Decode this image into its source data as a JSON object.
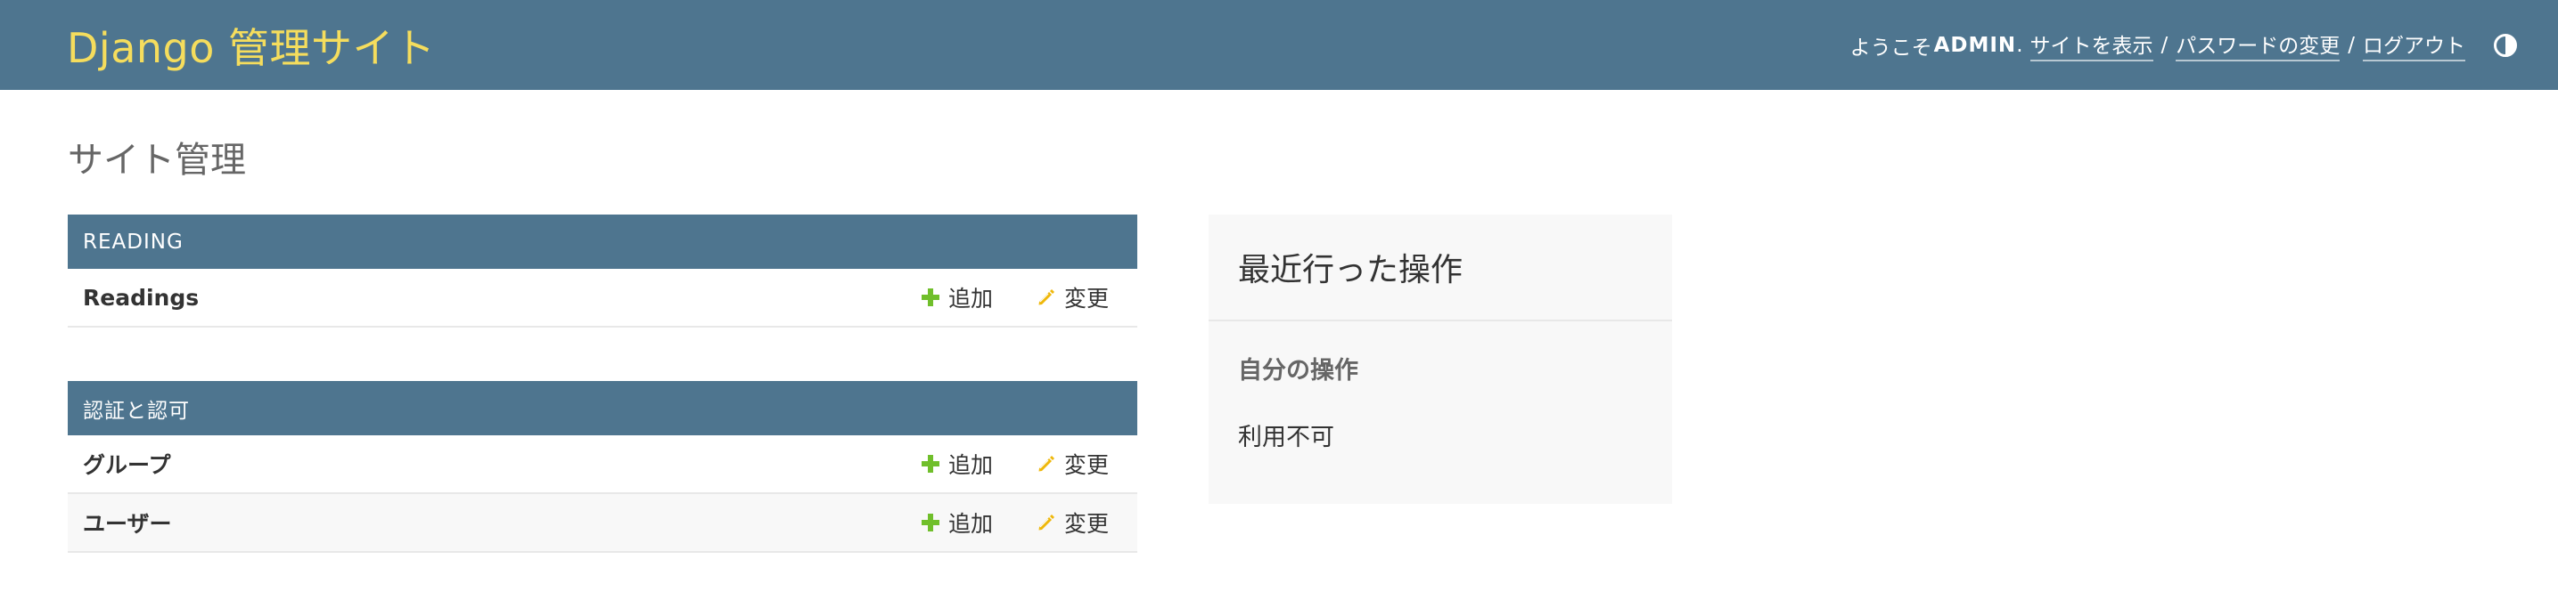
{
  "header": {
    "site_title": "Django 管理サイト",
    "welcome": "ようこそ",
    "username": "ADMIN",
    "username_suffix": ".",
    "view_site": "サイトを表示",
    "separator": "/",
    "change_password": "パスワードの変更",
    "logout": "ログアウト",
    "theme_toggle_icon": "half-circle-icon"
  },
  "page": {
    "title": "サイト管理"
  },
  "apps": [
    {
      "caption": "READING",
      "models": [
        {
          "name": "Readings",
          "add": "追加",
          "change": "変更"
        }
      ]
    },
    {
      "caption": "認証と認可",
      "models": [
        {
          "name": "グループ",
          "add": "追加",
          "change": "変更"
        },
        {
          "name": "ユーザー",
          "add": "追加",
          "change": "変更"
        }
      ]
    }
  ],
  "recent_actions": {
    "title": "最近行った操作",
    "my_actions": "自分の操作",
    "none_available": "利用不可"
  },
  "colors": {
    "header_bg": "#4e758f",
    "brand": "#f5dd5d",
    "add_icon": "#70bf2b",
    "change_icon": "#efb80b"
  }
}
